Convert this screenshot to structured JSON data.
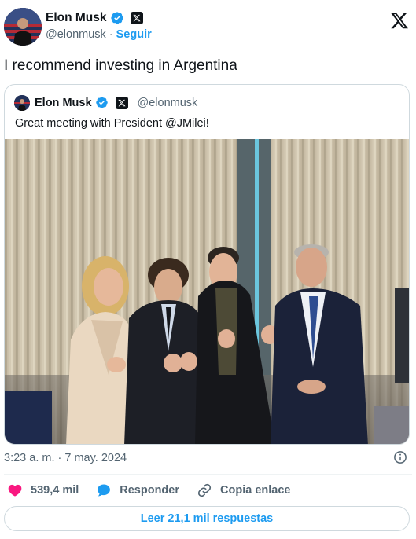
{
  "author": {
    "name": "Elon Musk",
    "handle": "@elonmusk",
    "separator": "·",
    "follow_label": "Seguir"
  },
  "tweet": {
    "text": "I recommend investing in Argentina",
    "timestamp": "3:23 a. m. · 7 may. 2024"
  },
  "quoted": {
    "name": "Elon Musk",
    "handle": "@elonmusk",
    "text": "Great meeting with President @JMilei!"
  },
  "actions": {
    "likes": "539,4 mil",
    "reply_label": "Responder",
    "copy_link_label": "Copia enlace"
  },
  "read_replies_label": "Leer 21,1 mil respuestas",
  "icons": [
    "verified-icon",
    "x-affiliate-icon",
    "x-logo-icon",
    "info-icon",
    "heart-icon",
    "reply-icon",
    "link-icon"
  ],
  "colors": {
    "accent": "#1d9bf0",
    "like": "#f91880",
    "text": "#0f1419",
    "muted": "#536471",
    "border": "#cfd9de"
  }
}
